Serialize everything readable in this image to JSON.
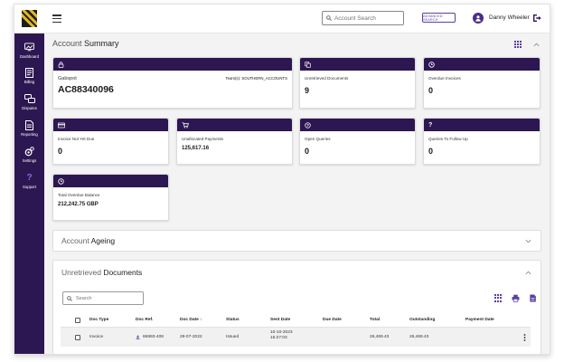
{
  "header": {
    "search_placeholder": "Account Search",
    "advanced_search_label": "ADVANCED SEARCH",
    "user_name": "Danny Wheeler"
  },
  "sidebar": {
    "items": [
      {
        "label": "Dashboard",
        "icon": "dashboard-icon"
      },
      {
        "label": "Billing",
        "icon": "billing-icon"
      },
      {
        "label": "Disputes",
        "icon": "disputes-icon"
      },
      {
        "label": "Reporting",
        "icon": "reporting-icon"
      },
      {
        "label": "Settings",
        "icon": "settings-icon"
      },
      {
        "label": "Support",
        "icon": "support-icon"
      }
    ]
  },
  "summary": {
    "title_light": "Account ",
    "title_bold": "Summary",
    "account": {
      "label": "Gabspot",
      "value": "AC88340096",
      "team_label": "Team(s): SOUTHERN_ACCOUNTS",
      "icon": "lock-icon"
    },
    "cards": [
      {
        "label": "Unretrieved Documents",
        "value": "9",
        "icon": "copy-icon"
      },
      {
        "label": "Overdue Invoices",
        "value": "0",
        "icon": "clock-icon"
      },
      {
        "label": "Invoice Not Yet Due",
        "value": "0",
        "icon": "card-icon"
      },
      {
        "label": "Unallocated Payments",
        "value": "125,617.16",
        "icon": "cart-icon"
      },
      {
        "label": "Open Queries",
        "value": "0",
        "icon": "question-icon"
      },
      {
        "label": "Queries To Follow Up",
        "value": "0",
        "icon": "question-icon"
      },
      {
        "label": "Total Overdue Balance",
        "value": "212,242.75 GBP",
        "icon": "clock-icon"
      }
    ]
  },
  "ageing": {
    "title_light": "Account ",
    "title_bold": "Ageing"
  },
  "documents": {
    "title_light": "Unretrieved ",
    "title_bold": "Documents",
    "search_placeholder": "Search",
    "columns": [
      "Doc Type",
      "Doc Ref.",
      "Doc Date",
      "Status",
      "Sent Date",
      "Due Date",
      "Total",
      "Outstanding",
      "Payment Date"
    ],
    "sort_indicator": "↓",
    "rows": [
      {
        "doc_type": "Invoice",
        "doc_ref": "66993-408",
        "doc_date": "29-07-2022",
        "status": "Issued",
        "sent_date_line1": "10-10-2023",
        "sent_date_line2": "15:27:03",
        "due_date": "",
        "total": "26,469.43",
        "outstanding": "26,469.43",
        "payment_date": ""
      }
    ]
  },
  "colors": {
    "brand_purple": "#2d1752",
    "accent_purple": "#5b3fa0",
    "logo_gold": "#e2b824"
  }
}
